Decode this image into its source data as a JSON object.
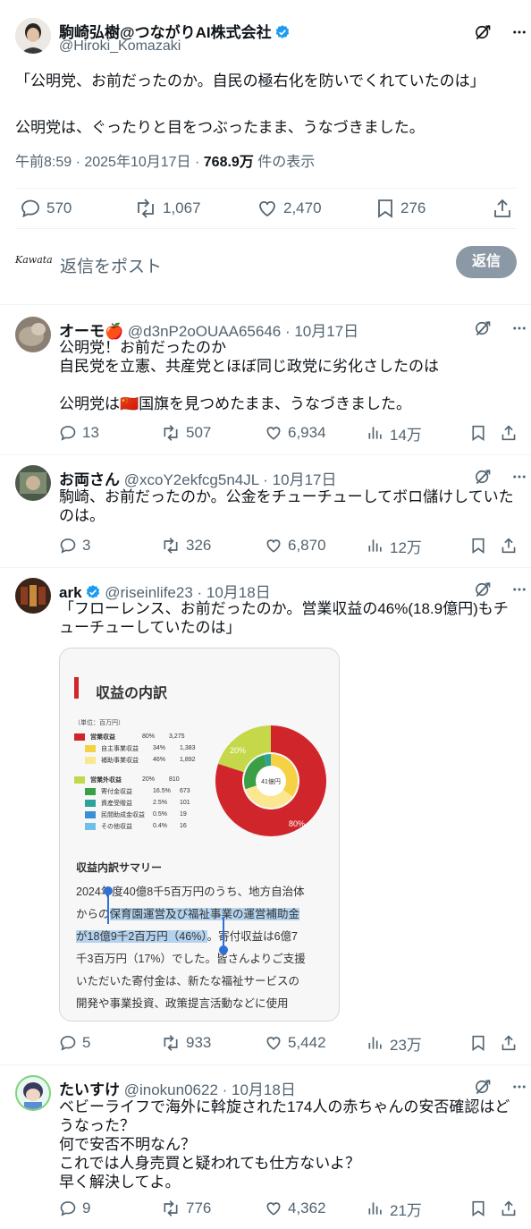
{
  "main": {
    "author_name": "駒崎弘樹@つながりAI株式会社",
    "handle": "@Hiroki_Komazaki",
    "text": "「公明党、お前だったのか。自民の極右化を防いでくれていたのは」\n\n公明党は、ぐったりと目をつぶったまま、うなづきました。",
    "time": "午前8:59 · 2025年10月17日 · ",
    "views": "768.9万",
    "views_suffix": " 件の表示",
    "replies": "570",
    "reposts": "1,067",
    "likes": "2,470",
    "bookmarks": "276"
  },
  "composer": {
    "avatar_text": "Kawata",
    "placeholder": "返信をポスト",
    "reply_button": "返信"
  },
  "replies": [
    {
      "name": "オーモ🍎",
      "meta": "@d3nP2oOUAA65646 · 10月17日",
      "text": "公明党！お前だったのか\n自民党を立憲、共産党とほぼ同じ政党に劣化さしたのは\n\n公明党は🇨🇳国旗を見つめたまま、うなづきました。",
      "replies": "13",
      "reposts": "507",
      "likes": "6,934",
      "views": "14万"
    },
    {
      "name": "お両さん",
      "meta": "@xcoY2ekfcg5n4JL · 10月17日",
      "text": "駒崎、お前だったのか。公金をチューチューしてボロ儲けしていたのは。",
      "replies": "3",
      "reposts": "326",
      "likes": "6,870",
      "views": "12万"
    },
    {
      "name": "ark",
      "meta": "@riseinlife23 · 10月18日",
      "text": "「フローレンス、お前だったのか。営業収益の46%(18.9億円)もチューチューしていたのは」",
      "replies": "5",
      "reposts": "933",
      "likes": "5,442",
      "views": "23万"
    },
    {
      "name": "たいすけ",
      "meta": "@inokun0622 · 10月18日",
      "text": "ベビーライフで海外に斡旋された174人の赤ちゃんの安否確認はどうなった？\n何で安否不明なん？\nこれでは人身売買と疑われても仕方ないよ？\n早く解決してよ。",
      "replies": "9",
      "reposts": "776",
      "likes": "4,362",
      "views": "21万"
    }
  ],
  "embedded": {
    "title": "収益の内訳",
    "unit": "（単位：百万円）",
    "legend_group1": [
      "営業収益",
      "80%",
      "3,275"
    ],
    "legend_items1": [
      [
        "自主事業収益",
        "34%",
        "1,383"
      ],
      [
        "補助事業収益",
        "46%",
        "1,892"
      ]
    ],
    "legend_group2": [
      "営業外収益",
      "20%",
      "810"
    ],
    "legend_items2": [
      [
        "寄付金収益",
        "16.5%",
        "673"
      ],
      [
        "資産受贈益",
        "2.5%",
        "101"
      ],
      [
        "民間助成金収益",
        "0.5%",
        "19"
      ],
      [
        "その他収益",
        "0.4%",
        "16"
      ]
    ],
    "center": "41億円",
    "pct_outer1": "80%",
    "pct_outer2": "20%",
    "summary_title": "収益内訳サマリー",
    "summary_l1": "2024年度40億8千5百万円のうち、地方自治体",
    "summary_l2a": "からの",
    "summary_l2b": "保育園運営及び福祉事業の運営補助金",
    "summary_l3a": "が18億9千2百万円（46%）",
    "summary_l3b": "。寄付収益は6億7",
    "summary_l4": "千3百万円（17%）でした。皆さんよりご支援",
    "summary_l5": "いただいた寄付金は、新たな福祉サービスの",
    "summary_l6": "開発や事業投資、政策提言活動などに使用",
    "colors": {
      "red": "#d0262b",
      "yellow": "#f6d144",
      "lightgreen": "#c5d84a",
      "green": "#3a9f46",
      "teal": "#2ba39a",
      "blue": "#3b8fd6",
      "lightblue": "#6ec1e4"
    }
  }
}
